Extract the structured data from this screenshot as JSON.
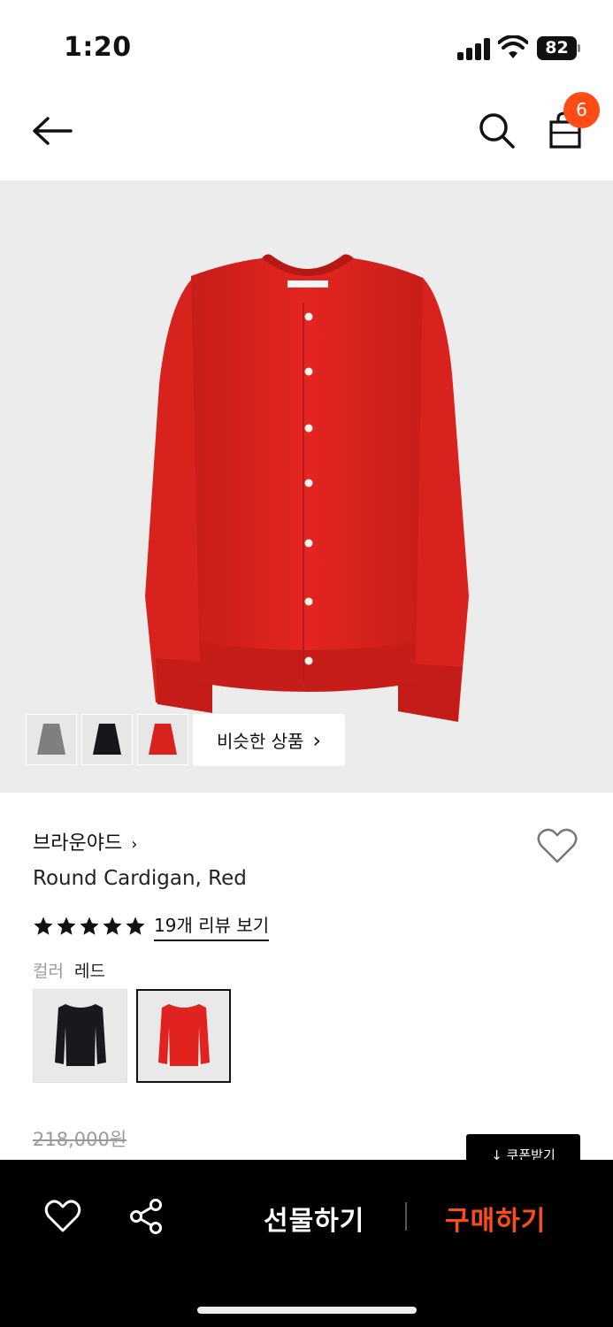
{
  "status_bar": {
    "time": "1:20",
    "battery": "82"
  },
  "header": {
    "cart_count": "6",
    "icons": [
      "back-arrow-icon",
      "search-icon",
      "shopping-bag-icon"
    ]
  },
  "hero": {
    "thumbnails": [
      "grey-cardigan",
      "black-cardigan",
      "red-cardigan"
    ],
    "similar_label": "비슷한 상품",
    "similar_chevron": "›"
  },
  "product": {
    "brand": "브라운야드",
    "brand_chevron": "›",
    "name": "Round Cardigan, Red",
    "rating_stars": 5,
    "review_link": "19개 리뷰 보기",
    "color_label": "컬러",
    "color_value": "레드",
    "color_options": [
      "black",
      "red"
    ],
    "selected_color": "red",
    "original_price": "218,000원",
    "coupon_button": "↓ 쿠폰받기"
  },
  "bottom_bar": {
    "gift_label": "선물하기",
    "buy_label": "구매하기",
    "icons": [
      "heart-icon",
      "share-icon"
    ]
  },
  "colors": {
    "accent": "#ff4b14",
    "cardigan_red": "#e0231f",
    "background_grey": "#ececec"
  }
}
